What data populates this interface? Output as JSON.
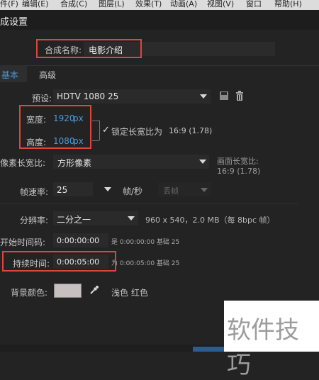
{
  "menu": [
    "件(F)",
    "编辑(E)",
    "合成(C)",
    "图层(L)",
    "效果(T)",
    "动画(A)",
    "视图(V)",
    "窗口",
    "帮助(H)"
  ],
  "dialog_title": "成设置",
  "comp_name": {
    "label": "合成名称:",
    "value": "电影介绍"
  },
  "tabs": [
    "基本",
    "高级"
  ],
  "preset": {
    "label": "预设:",
    "value": "HDTV 1080 25"
  },
  "width": {
    "label": "宽度:",
    "value": "1920",
    "unit": "px"
  },
  "height": {
    "label": "高度:",
    "value": "1080",
    "unit": "px"
  },
  "lock_aspect": {
    "label": "锁定长宽比为",
    "ratio": "16:9 (1.78)",
    "checked": true
  },
  "pixel_aspect": {
    "label": "像素长宽比:",
    "value": "方形像素"
  },
  "frame_aspect": {
    "label": "画面长宽比:",
    "value": "16:9 (1.78)"
  },
  "frame_rate": {
    "label": "帧速率:",
    "value": "25",
    "unit": "帧/秒",
    "drop": "丢帧"
  },
  "resolution": {
    "label": "分辨率:",
    "value": "二分之一",
    "info": "960 x 540，2.0 MB（每 8bpc 帧）"
  },
  "start_tc": {
    "label": "开始时间码:",
    "value": "0:00:00:00",
    "info": "是 0:00:00:00  基础 25"
  },
  "duration": {
    "label": "持续时间:",
    "value": "0:00:05:00",
    "info": "为 0:00:05:00  基础 25"
  },
  "bg_color": {
    "label": "背景颜色:",
    "swatch": "#c8c0c0",
    "name": "浅色 红色"
  },
  "watermark": "软件技巧",
  "colors": {
    "accent": "#4a9bd8",
    "highlight": "#e0453a"
  }
}
